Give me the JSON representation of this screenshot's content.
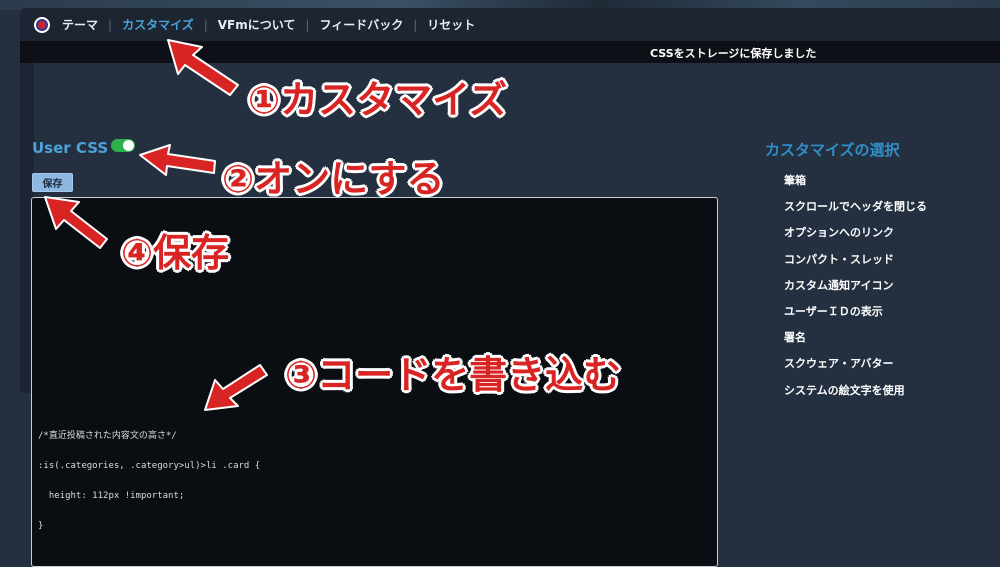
{
  "nav": {
    "items": [
      {
        "label": "テーマ"
      },
      {
        "label": "カスタマイズ"
      },
      {
        "label": "VFmについて"
      },
      {
        "label": "フィードバック"
      },
      {
        "label": "リセット"
      }
    ],
    "active_index": 1
  },
  "toast": {
    "message": "CSSをストレージに保存しました"
  },
  "user_css": {
    "title": "User CSS",
    "toggle_on": true,
    "save_label": "保存"
  },
  "editor": {
    "lines": [
      "/*直近投稿された内容文の高さ*/",
      ":is(.categories, .category>ul)>li .card {",
      "  height: 112px !important;",
      "}"
    ]
  },
  "right_panel": {
    "title": "カスタマイズの選択",
    "items": [
      "筆箱",
      "スクロールでヘッダを閉じる",
      "オプションへのリンク",
      "コンパクト・スレッド",
      "カスタム通知アイコン",
      "ユーザーＩＤの表示",
      "署名",
      "スクウェア・アバター",
      "システムの絵文字を使用"
    ]
  },
  "annotations": {
    "step1": "①カスタマイズ",
    "step2": "②オンにする",
    "step3": "③コードを書き込む",
    "step4": "④保存"
  },
  "colors": {
    "background": "#243040",
    "navbar": "#1c2531",
    "accent": "#4aa3d8",
    "toggle": "#2bb24c",
    "annotation": "#d92424"
  }
}
